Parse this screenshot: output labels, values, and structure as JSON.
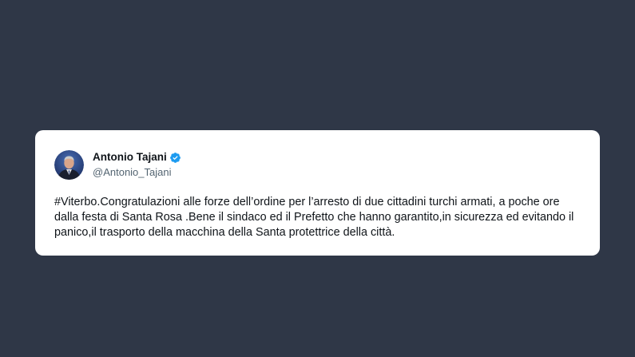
{
  "tweet": {
    "author": {
      "display_name": "Antonio Tajani",
      "handle": "@Antonio_Tajani",
      "verified": true,
      "avatar_icon": "profile-photo"
    },
    "text": "#Viterbo.Congratulazioni alle forze dell’ordine per l’arresto di due cittadini turchi armati, a poche ore dalla festa di Santa Rosa .Bene il sindaco ed il Prefetto che hanno garantito,in sicurezza ed evitando il panico,il trasporto della macchina della Santa protettrice della città."
  },
  "colors": {
    "page_background": "#2f3747",
    "card_background": "#ffffff",
    "verified_badge": "#1d9bf0",
    "text_primary": "#0f1419",
    "text_secondary": "#536471"
  }
}
